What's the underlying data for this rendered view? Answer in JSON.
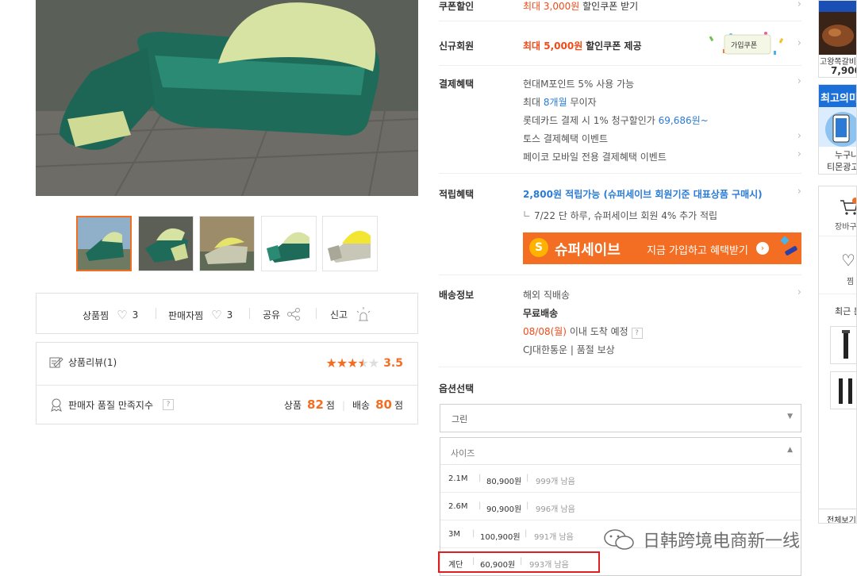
{
  "gallery": {
    "thumbs": [
      "thumb-1",
      "thumb-2",
      "thumb-3",
      "thumb-4",
      "thumb-5"
    ]
  },
  "actions": {
    "product_wish_label": "상품찜",
    "product_wish_count": "3",
    "seller_wish_label": "판매자찜",
    "seller_wish_count": "3",
    "share_label": "공유",
    "report_label": "신고"
  },
  "review": {
    "label": "상품리뷰(1)",
    "score": "3.5",
    "rating": 3.5
  },
  "seller_quality": {
    "label": "판매자 품질 만족지수",
    "help": "?",
    "product_label": "상품",
    "product_score": "82",
    "product_unit": "점",
    "delivery_label": "배송",
    "delivery_score": "80",
    "delivery_unit": "점"
  },
  "coupon": {
    "label": "쿠폰할인",
    "text_red": "최대 3,000원",
    "text_rest": "할인쿠폰 받기"
  },
  "new_member": {
    "label": "신규회원",
    "text_red": "최대 5,000원",
    "text_rest": "할인쿠폰 제공",
    "badge": "가입쿠폰"
  },
  "payment": {
    "label": "결제혜택",
    "line1": "현대M포인트 5% 사용 가능",
    "line2_a": "최대",
    "line2_b": "8개월",
    "line2_c": "무이자",
    "line3_a": "롯데카드 결제 시 1% 청구할인가",
    "line3_b": "69,686원~",
    "line4": "토스 결제혜택 이벤트",
    "line5": "페이코 모바일 전용 결제혜택 이벤트"
  },
  "points": {
    "label": "적립혜택",
    "main": "2,800원 적립가능 (슈퍼세이브 회원기준 대표상품 구매시)",
    "sub": "7/22 단 하루, 슈퍼세이브 회원 4% 추가 적립",
    "banner_brand": "슈퍼세이브",
    "banner_text": "지금 가입하고 혜택받기"
  },
  "delivery": {
    "label": "배송정보",
    "line1": "해외 직배송",
    "line2": "무료배송",
    "line3_a": "08/08(월)",
    "line3_b": "이내 도착 예정",
    "line3_help": "?",
    "line4": "CJ대한통운 | 품절 보상"
  },
  "options": {
    "label": "옵션선택",
    "select1_value": "그린",
    "select2_value": "사이즈",
    "items": [
      {
        "name": "2.1M",
        "price": "80,900원",
        "stock": "999개 남음"
      },
      {
        "name": "2.6M",
        "price": "90,900원",
        "stock": "996개 남음"
      },
      {
        "name": "3M",
        "price": "100,900원",
        "stock": "991개 남음"
      },
      {
        "name": "계단",
        "price": "60,900원",
        "stock": "993개 남음"
      }
    ]
  },
  "sidebar": {
    "ad1_text": "고왕쪽갈비",
    "ad1_price": "7,900",
    "ad2_title": "최고의미",
    "ad2_text1": "누구나",
    "ad2_text2": "티몬광고",
    "cart_label": "장바구",
    "wish_label": "찜",
    "recent_label": "최근 본",
    "view_all": "전체보기"
  },
  "watermark": "日韩跨境电商新一线"
}
